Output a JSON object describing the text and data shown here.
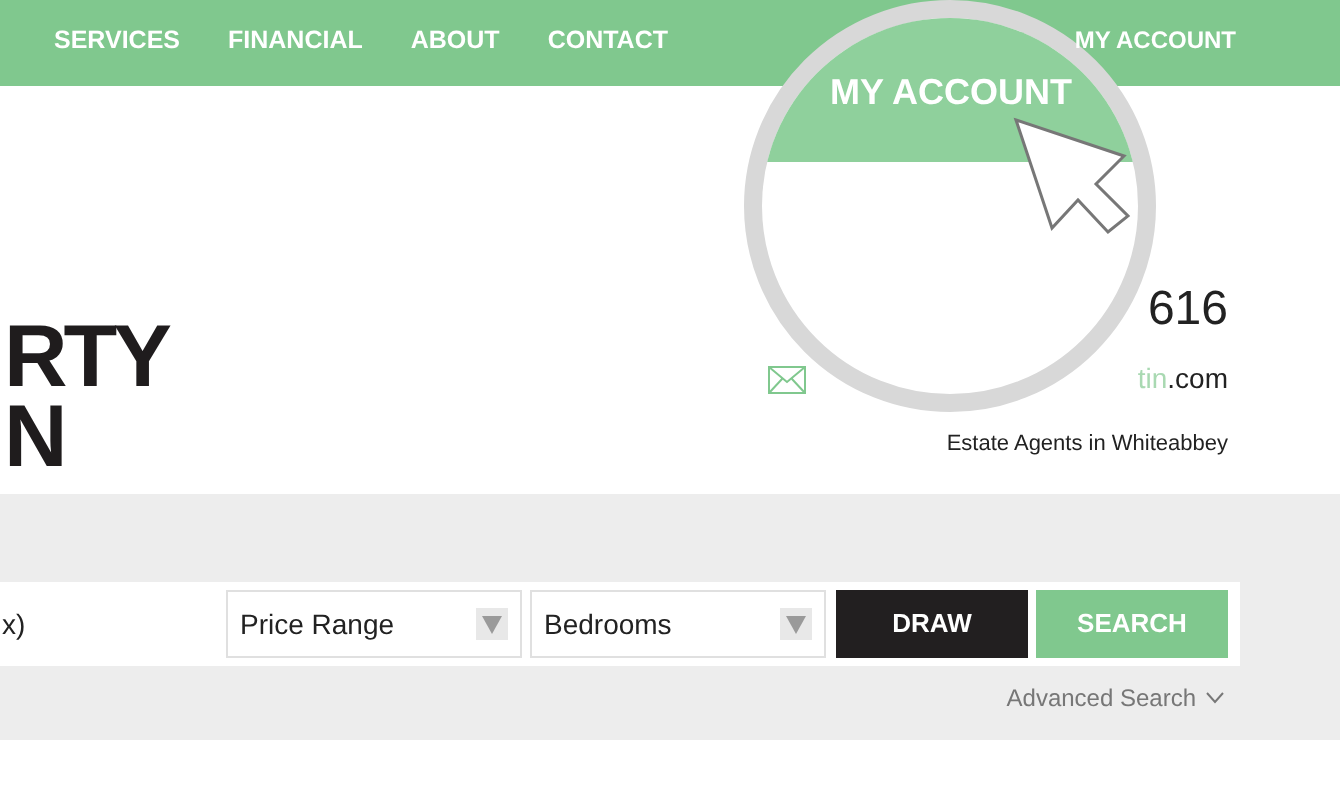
{
  "nav": {
    "items": [
      "SERVICES",
      "FINANCIAL",
      "ABOUT",
      "CONTACT"
    ],
    "account": "MY ACCOUNT"
  },
  "magnifier": {
    "label": "MY ACCOUNT"
  },
  "logo": [
    "RTY",
    "N"
  ],
  "contact": {
    "phone": "616",
    "email_highlight": "tin",
    "email_rest": ".com",
    "tagline": "Estate Agents in Whiteabbey"
  },
  "search": {
    "query": "x)",
    "selects": [
      "Price Range",
      "Bedrooms"
    ],
    "draw_button": "DRAW",
    "search_button": "SEARCH",
    "advanced": "Advanced Search"
  }
}
